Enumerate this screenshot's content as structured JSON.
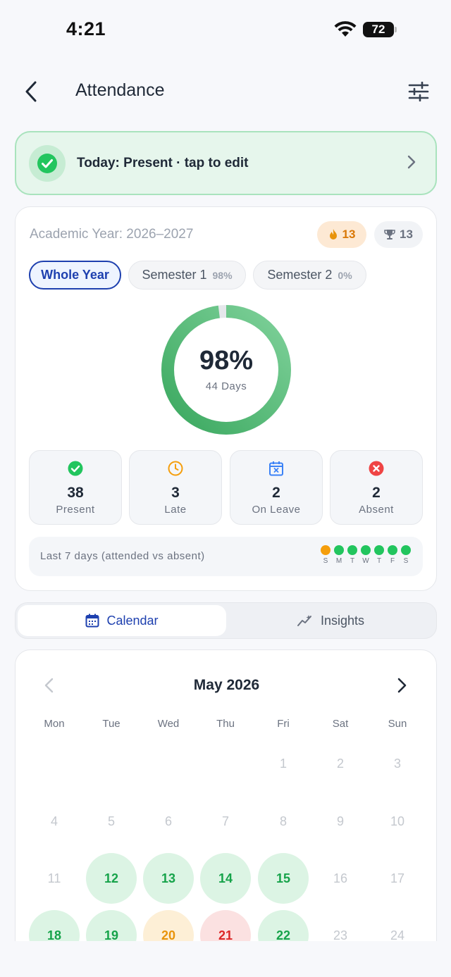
{
  "status": {
    "time": "4:21",
    "battery": "72"
  },
  "nav": {
    "title": "Attendance"
  },
  "today": {
    "text": "Today: Present · tap to edit"
  },
  "summary": {
    "academic_year": "Academic Year: 2026–2027",
    "streak": "13",
    "trophies": "13",
    "segments": [
      {
        "label": "Whole Year",
        "pct": ""
      },
      {
        "label": "Semester 1",
        "pct": "98%"
      },
      {
        "label": "Semester 2",
        "pct": "0%"
      }
    ],
    "donut": {
      "pct_text": "98%",
      "days_text": "44 Days",
      "fraction": 0.98
    },
    "stats": [
      {
        "value": "38",
        "label": "Present",
        "icon": "check-circle-icon",
        "color": "#22c55e"
      },
      {
        "value": "3",
        "label": "Late",
        "icon": "clock-icon",
        "color": "#f59e0b"
      },
      {
        "value": "2",
        "label": "On Leave",
        "icon": "calendar-x-icon",
        "color": "#3b82f6"
      },
      {
        "value": "2",
        "label": "Absent",
        "icon": "x-circle-icon",
        "color": "#ef4444"
      }
    ],
    "last7": {
      "label": "Last 7 days (attended vs absent)",
      "days": [
        "S",
        "M",
        "T",
        "W",
        "T",
        "F",
        "S"
      ],
      "status": [
        "late",
        "present",
        "present",
        "present",
        "present",
        "present",
        "present"
      ]
    }
  },
  "tabs": [
    {
      "label": "Calendar",
      "icon": "calendar-icon"
    },
    {
      "label": "Insights",
      "icon": "trend-icon"
    }
  ],
  "calendar": {
    "month": "May 2026",
    "weekdays": [
      "Mon",
      "Tue",
      "Wed",
      "Thu",
      "Fri",
      "Sat",
      "Sun"
    ],
    "weeks": [
      [
        null,
        null,
        null,
        null,
        {
          "d": "1",
          "s": ""
        },
        {
          "d": "2",
          "s": ""
        },
        {
          "d": "3",
          "s": ""
        }
      ],
      [
        {
          "d": "4",
          "s": ""
        },
        {
          "d": "5",
          "s": ""
        },
        {
          "d": "6",
          "s": ""
        },
        {
          "d": "7",
          "s": ""
        },
        {
          "d": "8",
          "s": ""
        },
        {
          "d": "9",
          "s": ""
        },
        {
          "d": "10",
          "s": ""
        }
      ],
      [
        {
          "d": "11",
          "s": ""
        },
        {
          "d": "12",
          "s": "present"
        },
        {
          "d": "13",
          "s": "present"
        },
        {
          "d": "14",
          "s": "present"
        },
        {
          "d": "15",
          "s": "present"
        },
        {
          "d": "16",
          "s": ""
        },
        {
          "d": "17",
          "s": ""
        }
      ],
      [
        {
          "d": "18",
          "s": "present"
        },
        {
          "d": "19",
          "s": "present"
        },
        {
          "d": "20",
          "s": "late"
        },
        {
          "d": "21",
          "s": "absent"
        },
        {
          "d": "22",
          "s": "present"
        },
        {
          "d": "23",
          "s": ""
        },
        {
          "d": "24",
          "s": ""
        }
      ]
    ]
  },
  "colors": {
    "accent": "#1e40af",
    "present": "#22c55e",
    "late": "#f59e0b",
    "absent": "#ef4444"
  }
}
